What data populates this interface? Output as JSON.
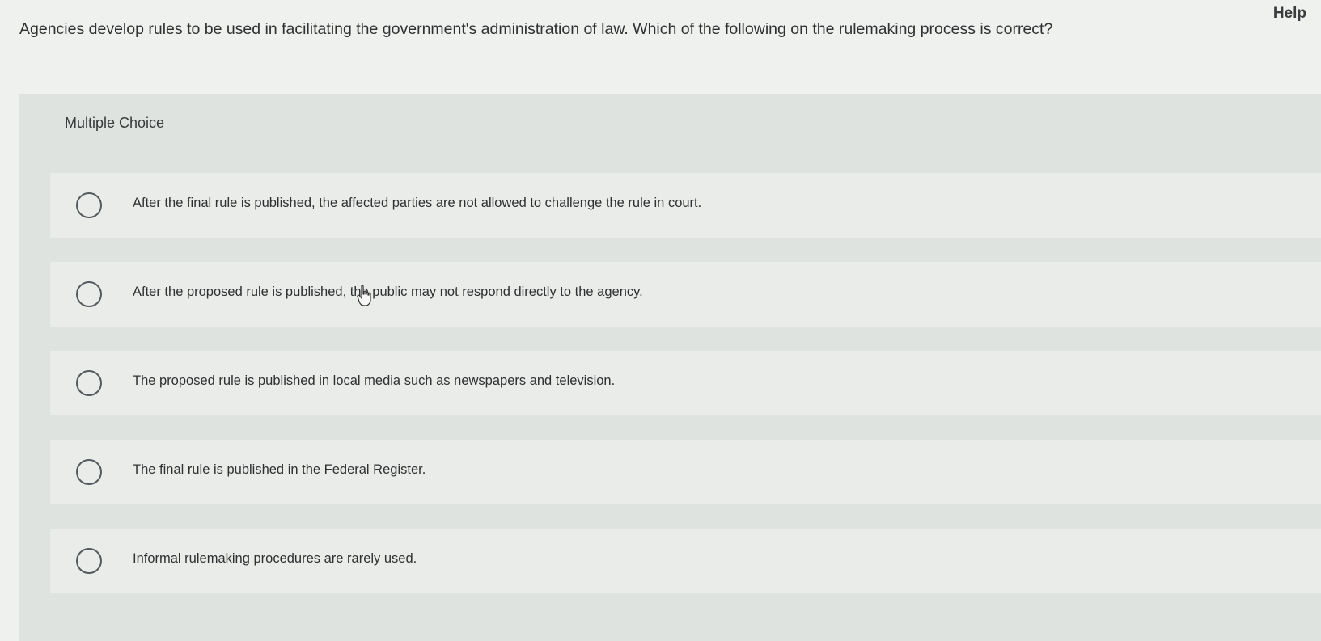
{
  "header": {
    "help_label": "Help"
  },
  "question": {
    "text": "Agencies develop rules to be used in facilitating the government's administration of law. Which of the following on the rulemaking process is correct?"
  },
  "multiple_choice": {
    "title": "Multiple Choice",
    "options": [
      {
        "label": "After the final rule is published, the affected parties are not allowed to challenge the rule in court."
      },
      {
        "label": "After the proposed rule is published, the public may not respond directly to the agency."
      },
      {
        "label": "The proposed rule is published in local media such as newspapers and television."
      },
      {
        "label": "The final rule is published in the Federal Register."
      },
      {
        "label": "Informal rulemaking procedures are rarely used."
      }
    ]
  }
}
